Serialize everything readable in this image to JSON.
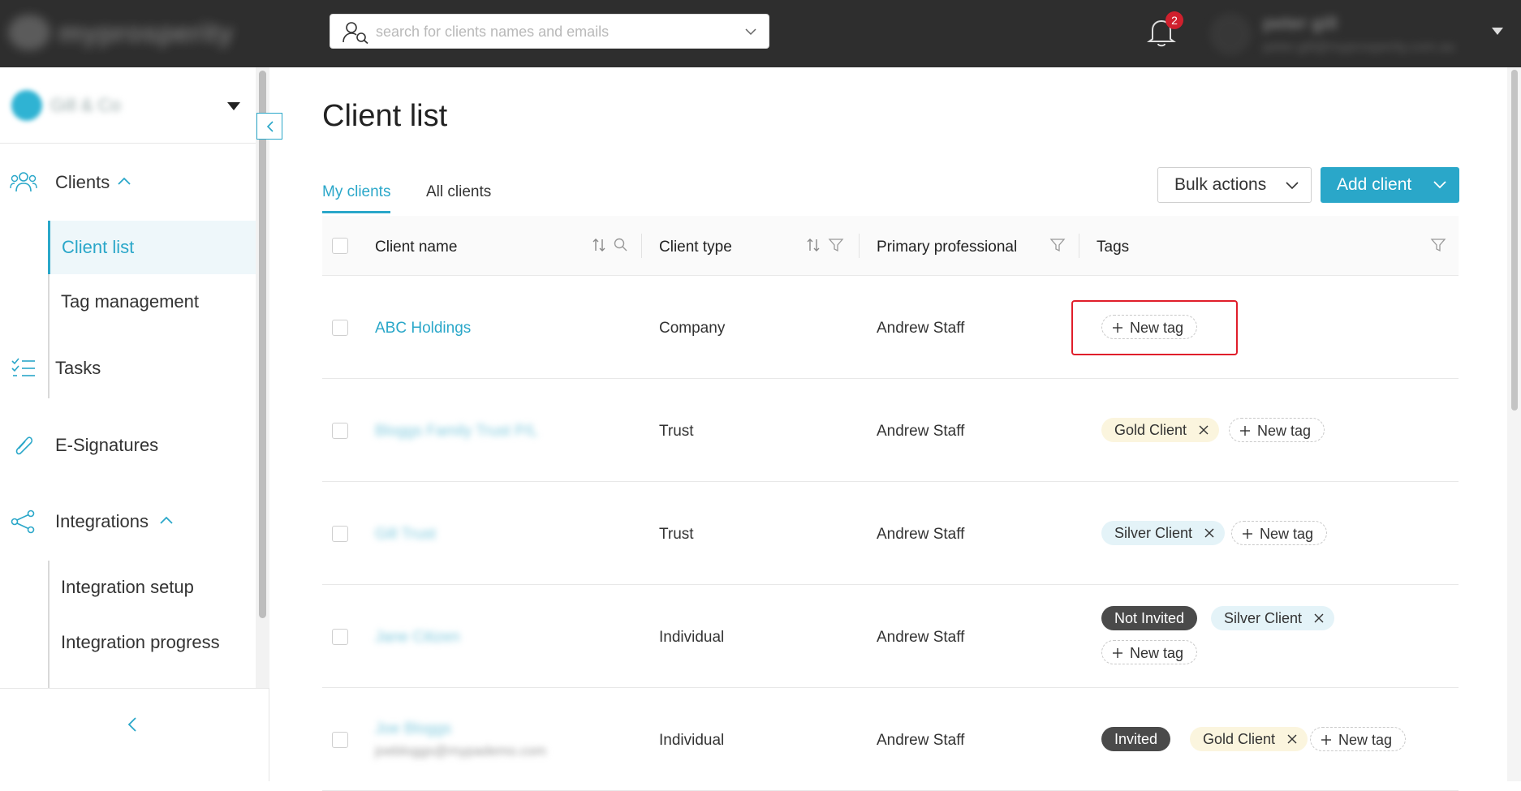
{
  "topbar": {
    "logo_text": "myprosperity",
    "search": {
      "placeholder": "search for clients names and emails",
      "value": ""
    },
    "notifications": {
      "count": "2"
    },
    "user": {
      "name": "peter gill",
      "email": "peter.gill@myprosperity.com.au"
    }
  },
  "sidebar": {
    "org_name": "Gill & Co",
    "nav": {
      "clients": {
        "label": "Clients",
        "subitems": [
          "Client list",
          "Tag management"
        ]
      },
      "tasks": {
        "label": "Tasks"
      },
      "esignatures": {
        "label": "E-Signatures"
      },
      "integrations": {
        "label": "Integrations",
        "subitems": [
          "Integration setup",
          "Integration progress"
        ]
      }
    }
  },
  "main": {
    "title": "Client list",
    "tabs": [
      "My clients",
      "All clients"
    ],
    "active_tab": "My clients",
    "buttons": {
      "bulk": "Bulk actions",
      "add": "Add client"
    },
    "columns": [
      "Client name",
      "Client type",
      "Primary professional",
      "Tags"
    ],
    "new_tag_label": "New tag",
    "rows": [
      {
        "name": "ABC Holdings",
        "email": "",
        "type": "Company",
        "professional": "Andrew Staff",
        "tags": []
      },
      {
        "name": "Bloggs Family Trust P/L",
        "email": "",
        "type": "Trust",
        "professional": "Andrew Staff",
        "tags": [
          "Gold Client"
        ]
      },
      {
        "name": "Gill Trust",
        "email": "",
        "type": "Trust",
        "professional": "Andrew Staff",
        "tags": [
          "Silver Client"
        ]
      },
      {
        "name": "Jane Citizen",
        "email": "",
        "type": "Individual",
        "professional": "Andrew Staff",
        "status": "Not Invited",
        "tags": [
          "Silver Client"
        ]
      },
      {
        "name": "Joe Bloggs",
        "email": "joebloggs@mypademo.com",
        "type": "Individual",
        "professional": "Andrew Staff",
        "status": "Invited",
        "tags": [
          "Gold Client"
        ]
      }
    ]
  },
  "colors": {
    "accent": "#2aa7c9",
    "topbar": "#2e2e2e",
    "badge": "#d0202d",
    "highlight": "#e01e2b"
  }
}
